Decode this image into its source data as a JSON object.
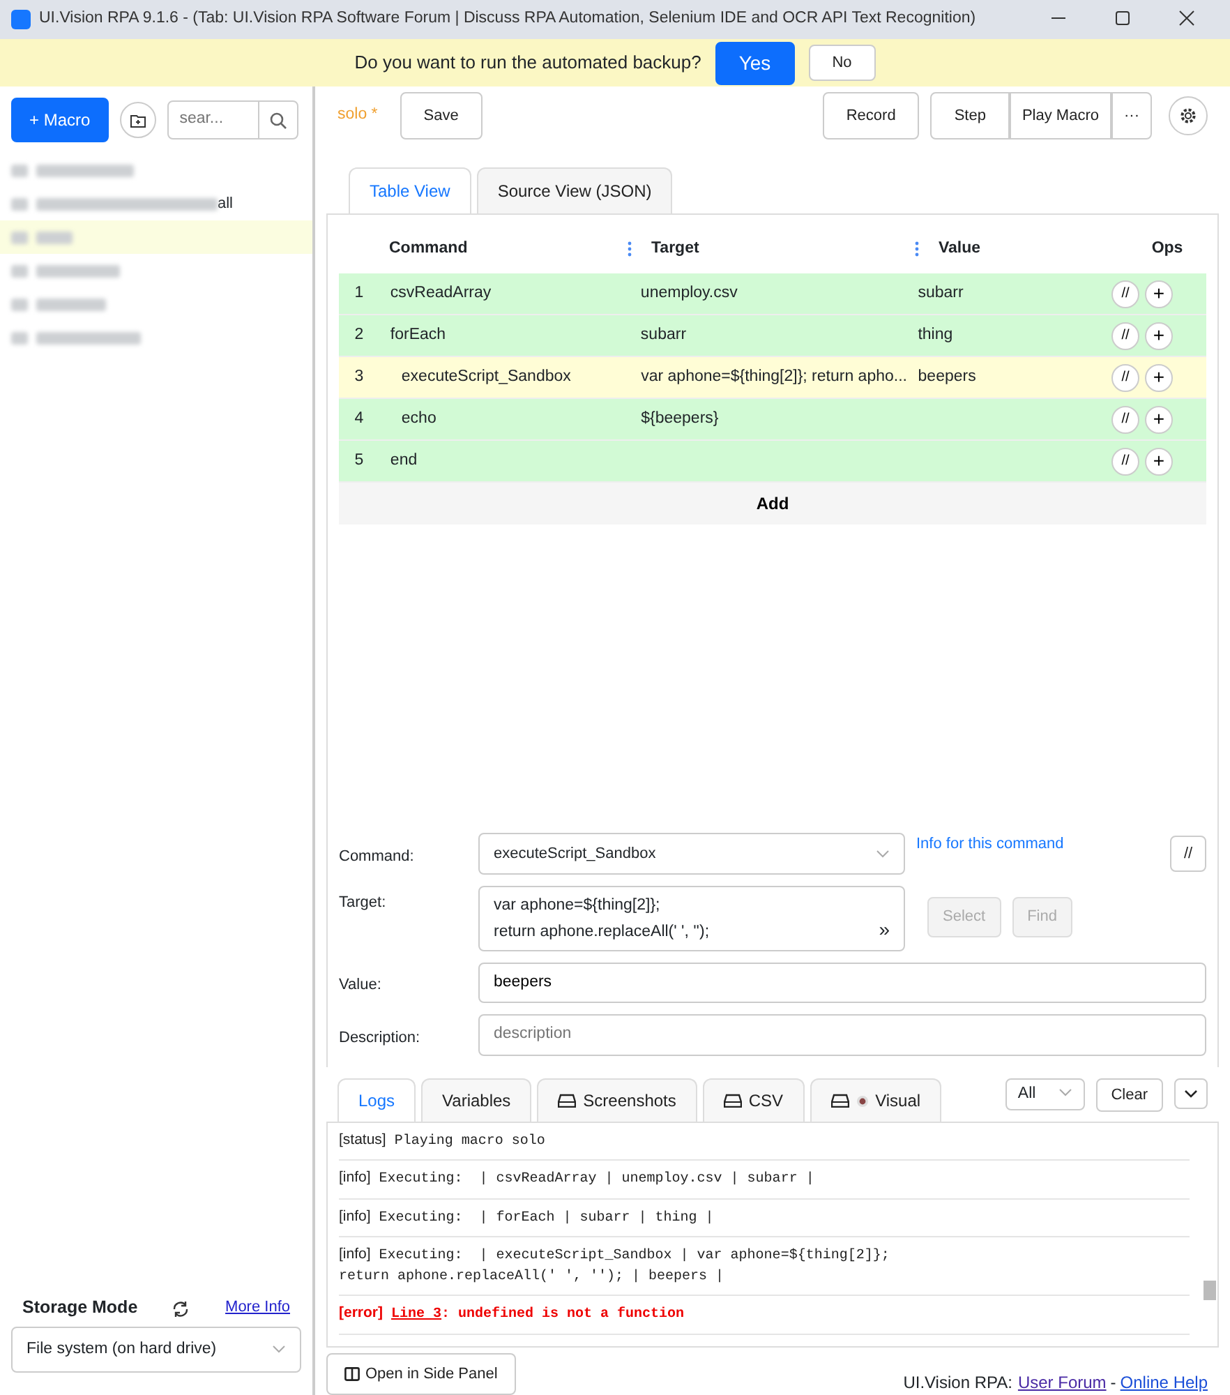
{
  "window": {
    "title": "UI.Vision RPA 9.1.6 - (Tab: UI.Vision RPA Software Forum | Discuss RPA Automation, Selenium IDE and OCR API Text Recognition)"
  },
  "banner": {
    "text": "Do you want to run the automated backup?",
    "buttons": [
      "Yes",
      "No"
    ]
  },
  "sidebar": {
    "new_macro": "+ Macro",
    "search": {
      "placeholder": "sear..."
    },
    "items": [
      {
        "selected": false
      },
      {
        "selected": false,
        "visible_tail": "all"
      },
      {
        "selected": true
      },
      {
        "selected": false
      },
      {
        "selected": false
      },
      {
        "selected": false
      }
    ],
    "storage": {
      "label": "Storage Mode",
      "link": "More Info",
      "value": "File system (on hard drive)"
    }
  },
  "toolbar": {
    "macro_name": "solo",
    "unsaved": "*",
    "save": "Save",
    "record": "Record",
    "step": "Step",
    "play": "Play Macro",
    "more": "···"
  },
  "tabs": [
    {
      "label": "Table View",
      "selected": true
    },
    {
      "label": "Source View (JSON)",
      "selected": false
    }
  ],
  "table": {
    "columns": [
      "Command",
      "Target",
      "Value",
      "Ops"
    ],
    "rows": [
      {
        "n": "1",
        "command": "csvReadArray",
        "target": "unemploy.csv",
        "value": "subarr",
        "selected": false
      },
      {
        "n": "2",
        "command": "forEach",
        "target": "subarr",
        "value": "thing",
        "selected": false,
        "children": [
          {
            "n": "3",
            "command": "executeScript_Sandbox",
            "target": "var aphone=${thing[2]}; return apho...",
            "value": "beepers",
            "selected": true
          },
          {
            "n": "4",
            "command": "echo",
            "target": "${beepers}",
            "selected": false
          }
        ]
      },
      {
        "n": "5",
        "command": "end",
        "selected": false
      }
    ],
    "add": "Add",
    "comment_button": "//",
    "insert_button": "+"
  },
  "editor": {
    "command_label": "Command:",
    "command": "executeScript_Sandbox",
    "info_link": "Info for this command",
    "comment_button": "//",
    "target_label": "Target:",
    "target_lines": [
      "var aphone=${thing[2]};",
      "return aphone.replaceAll(' ', '');"
    ],
    "expand": "»",
    "select": "Select",
    "find": "Find",
    "buttons_disabled": true,
    "value_label": "Value:",
    "value": "beepers",
    "description_label": "Description:",
    "description_placeholder": "description"
  },
  "log_tabs": [
    {
      "label": "Logs",
      "selected": true,
      "kind": "plain"
    },
    {
      "label": "Variables",
      "selected": false,
      "kind": "plain"
    },
    {
      "label": "Screenshots",
      "selected": false,
      "kind": "drive"
    },
    {
      "label": "CSV",
      "selected": false,
      "kind": "drive"
    },
    {
      "label": "Visual",
      "selected": false,
      "kind": "visual"
    }
  ],
  "log_filter": "All",
  "clear": "Clear",
  "logs": [
    {
      "kind": "status",
      "tag": "[status]",
      "text": "Playing macro solo"
    },
    {
      "kind": "info",
      "tag": "[info]",
      "text": "Executing:  | csvReadArray | unemploy.csv | subarr |"
    },
    {
      "kind": "info",
      "tag": "[info]",
      "text": "Executing:  | forEach | subarr | thing |"
    },
    {
      "kind": "info",
      "tag": "[info]",
      "text": "Executing:  | executeScript_Sandbox | var aphone=${thing[2]};\nreturn aphone.replaceAll(' ', ''); | beepers |"
    },
    {
      "kind": "error",
      "tag": "[error]",
      "link": "Line 3",
      "text": ": undefined is not a function"
    }
  ],
  "footer": {
    "side_panel": "Open in Side Panel",
    "brand": "UI.Vision RPA:",
    "links": [
      "User Forum",
      "Online Help"
    ],
    "separator": "-"
  }
}
